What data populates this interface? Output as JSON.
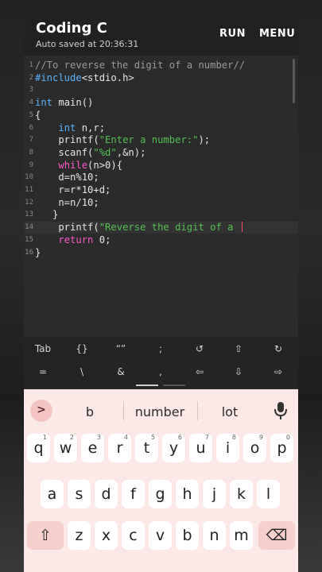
{
  "app": {
    "title": "Coding C",
    "subtitle": "Auto saved at 20:36:31",
    "run_label": "RUN",
    "menu_label": "MENU"
  },
  "editor": {
    "lines": [
      {
        "num": "1",
        "parts": [
          {
            "t": "//To reverse the digit of a number//",
            "c": "cmt"
          }
        ]
      },
      {
        "num": "2",
        "parts": [
          {
            "t": "#include",
            "c": "kw"
          },
          {
            "t": "<stdio.h>",
            "c": ""
          }
        ]
      },
      {
        "num": "3",
        "parts": []
      },
      {
        "num": "4",
        "parts": [
          {
            "t": "int",
            "c": "kw"
          },
          {
            "t": " main()",
            "c": ""
          }
        ]
      },
      {
        "num": "5",
        "parts": [
          {
            "t": "{",
            "c": ""
          }
        ]
      },
      {
        "num": "6",
        "parts": [
          {
            "t": "    ",
            "c": ""
          },
          {
            "t": "int",
            "c": "kw"
          },
          {
            "t": " n,r;",
            "c": ""
          }
        ]
      },
      {
        "num": "7",
        "parts": [
          {
            "t": "    printf(",
            "c": ""
          },
          {
            "t": "\"Enter a number:\"",
            "c": "str"
          },
          {
            "t": ");",
            "c": ""
          }
        ]
      },
      {
        "num": "8",
        "parts": [
          {
            "t": "    scanf(",
            "c": ""
          },
          {
            "t": "\"%d\"",
            "c": "str"
          },
          {
            "t": ",&n);",
            "c": ""
          }
        ]
      },
      {
        "num": "9",
        "parts": [
          {
            "t": "    ",
            "c": ""
          },
          {
            "t": "while",
            "c": "fn"
          },
          {
            "t": "(n>0){",
            "c": ""
          }
        ]
      },
      {
        "num": "10",
        "parts": [
          {
            "t": "    d=n%10;",
            "c": ""
          }
        ]
      },
      {
        "num": "11",
        "parts": [
          {
            "t": "    r=r*10+d;",
            "c": ""
          }
        ]
      },
      {
        "num": "12",
        "parts": [
          {
            "t": "    n=n/10;",
            "c": ""
          }
        ]
      },
      {
        "num": "13",
        "parts": [
          {
            "t": "   }",
            "c": ""
          }
        ]
      },
      {
        "num": "14",
        "parts": [
          {
            "t": "    printf(",
            "c": ""
          },
          {
            "t": "\"Reverse the digit of a ",
            "c": "str"
          }
        ],
        "current": true
      },
      {
        "num": "15",
        "parts": [
          {
            "t": "    ",
            "c": ""
          },
          {
            "t": "return",
            "c": "fn"
          },
          {
            "t": " 0;",
            "c": ""
          }
        ]
      },
      {
        "num": "16",
        "parts": [
          {
            "t": "}",
            "c": ""
          }
        ]
      }
    ]
  },
  "symbols": {
    "row1": [
      "Tab",
      "{}",
      "“”",
      ";",
      "↺",
      "⇧",
      "↻"
    ],
    "row2": [
      "=",
      "\\",
      "&",
      ",",
      "⇦",
      "⇩",
      "⇨"
    ]
  },
  "keyboard": {
    "suggestions": [
      "b",
      "number",
      "lot"
    ],
    "expand_glyph": ">",
    "row1": [
      [
        "q",
        "1"
      ],
      [
        "w",
        "2"
      ],
      [
        "e",
        "3"
      ],
      [
        "r",
        "4"
      ],
      [
        "t",
        "5"
      ],
      [
        "y",
        "6"
      ],
      [
        "u",
        "7"
      ],
      [
        "i",
        "8"
      ],
      [
        "o",
        "9"
      ],
      [
        "p",
        "0"
      ]
    ],
    "row2": [
      "a",
      "s",
      "d",
      "f",
      "g",
      "h",
      "j",
      "k",
      "l"
    ],
    "row3": [
      "z",
      "x",
      "c",
      "v",
      "b",
      "n",
      "m"
    ],
    "shift_glyph": "⇧",
    "backspace_glyph": "⌫"
  },
  "colors": {
    "accent": "#ff4a6a",
    "keyword": "#58b4ff",
    "string": "#52c152",
    "control": "#ff56c8",
    "comment": "#9a9a9a"
  }
}
